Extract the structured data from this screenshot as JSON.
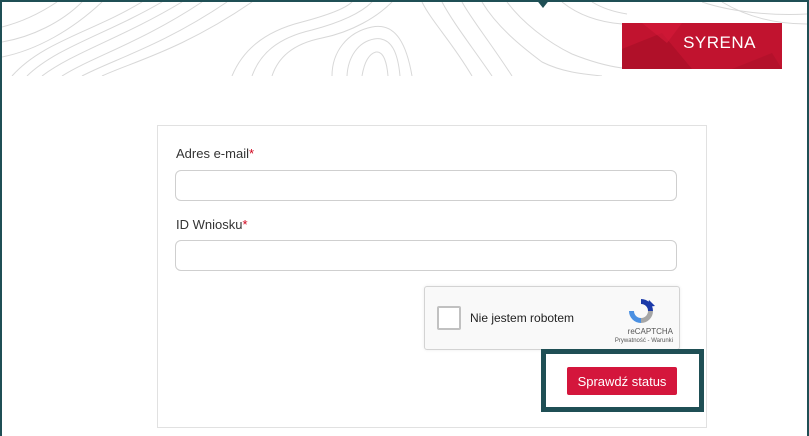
{
  "header": {
    "brand_label": "SYRENA"
  },
  "form": {
    "email": {
      "label": "Adres e-mail",
      "required_mark": "*",
      "value": ""
    },
    "application_id": {
      "label": "ID Wniosku",
      "required_mark": "*",
      "value": ""
    },
    "captcha": {
      "checkbox_label": "Nie jestem robotem",
      "brand": "reCAPTCHA",
      "links": "Prywatność - Warunki"
    },
    "submit_label": "Sprawdź status"
  },
  "colors": {
    "accent": "#d4163c",
    "frame": "#1f4f55",
    "brand_bg": "#c1132f"
  },
  "icons": {
    "captcha_logo": "recaptcha-icon",
    "header_pointer": "caret-down-icon"
  }
}
